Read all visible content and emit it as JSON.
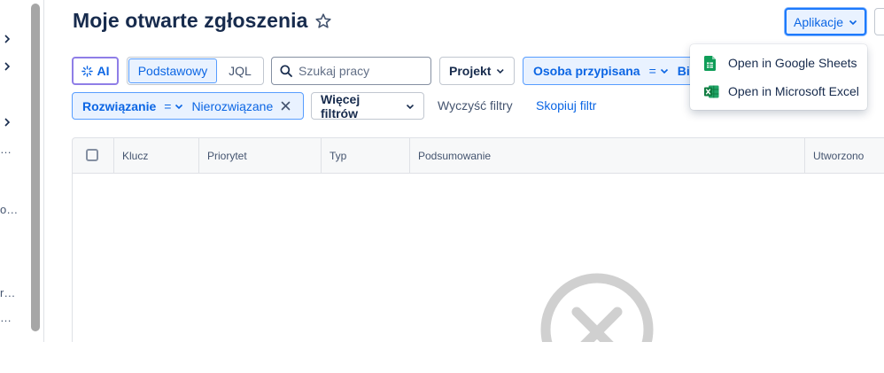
{
  "page": {
    "title": "Moje otwarte zgłoszenia"
  },
  "header": {
    "apps_label": "Aplikacje"
  },
  "sidebar": {
    "truncated_items": [
      "…",
      "o…",
      "r…",
      "…"
    ]
  },
  "toolbar": {
    "ai_label": "AI",
    "mode_basic": "Podstawowy",
    "mode_jql": "JQL",
    "search_placeholder": "Szukaj pracy",
    "project_label": "Projekt",
    "assignee_label": "Osoba przypisana",
    "assignee_operator": "=",
    "assignee_value": "Bi",
    "resolution_label": "Rozwiązanie",
    "resolution_operator": "=",
    "resolution_value": "Nierozwiązane",
    "more_filters_label": "Więcej filtrów",
    "clear_filters_label": "Wyczyść filtry",
    "copy_filter_label": "Skopiuj filtr"
  },
  "table": {
    "columns": [
      "Klucz",
      "Priorytet",
      "Typ",
      "Podsumowanie",
      "Utworzono"
    ]
  },
  "apps_menu": {
    "items": [
      {
        "label": "Open in Google Sheets",
        "icon": "google-sheets-icon",
        "color": "#0f9d58"
      },
      {
        "label": "Open in Microsoft Excel",
        "icon": "microsoft-excel-icon",
        "color": "#1d6f42"
      }
    ]
  },
  "colors": {
    "accent": "#0c66e4",
    "accent_bg": "#e9f2ff",
    "ai_border": "#8f7ee7"
  }
}
